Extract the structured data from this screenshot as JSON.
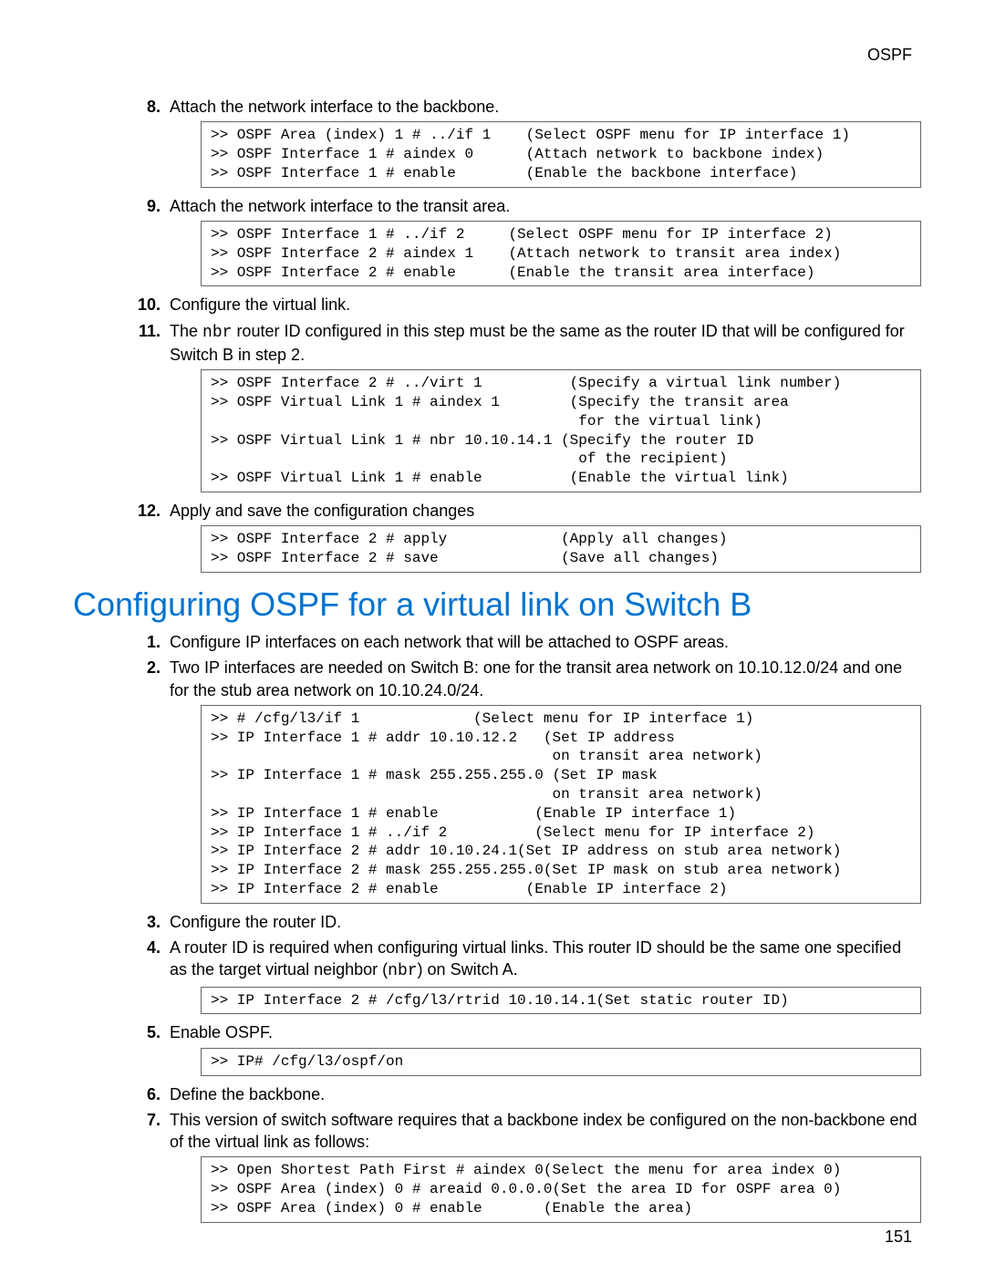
{
  "header": {
    "right": "OSPF"
  },
  "page_number": "151",
  "section_heading": "Configuring OSPF for a virtual link on Switch B",
  "stepsA": [
    {
      "num": "8.",
      "text": "Attach the network interface to the backbone."
    },
    {
      "num": "9.",
      "text": "Attach the network interface to the transit area."
    },
    {
      "num": "10.",
      "text": "Configure the virtual link."
    },
    {
      "num": "11.",
      "text_pre": "The ",
      "text_code": "nbr",
      "text_post": " router ID configured in this step must be the same as the router ID that will be configured for Switch B in step 2."
    },
    {
      "num": "12.",
      "text": "Apply and save the configuration changes"
    }
  ],
  "codeA": {
    "box1": ">> OSPF Area (index) 1 # ../if 1    (Select OSPF menu for IP interface 1)\n>> OSPF Interface 1 # aindex 0      (Attach network to backbone index)\n>> OSPF Interface 1 # enable        (Enable the backbone interface)",
    "box2": ">> OSPF Interface 1 # ../if 2     (Select OSPF menu for IP interface 2)\n>> OSPF Interface 2 # aindex 1    (Attach network to transit area index)\n>> OSPF Interface 2 # enable      (Enable the transit area interface)",
    "box3": ">> OSPF Interface 2 # ../virt 1          (Specify a virtual link number)\n>> OSPF Virtual Link 1 # aindex 1        (Specify the transit area\n                                          for the virtual link)\n>> OSPF Virtual Link 1 # nbr 10.10.14.1 (Specify the router ID\n                                          of the recipient)\n>> OSPF Virtual Link 1 # enable          (Enable the virtual link)",
    "box4": ">> OSPF Interface 2 # apply             (Apply all changes)\n>> OSPF Interface 2 # save              (Save all changes)"
  },
  "stepsB": [
    {
      "num": "1.",
      "text": "Configure IP interfaces on each network that will be attached to OSPF areas."
    },
    {
      "num": "2.",
      "text": "Two IP interfaces are needed on Switch B: one for the transit area network on 10.10.12.0/24 and one for the stub area network on 10.10.24.0/24."
    },
    {
      "num": "3.",
      "text": "Configure the router ID."
    },
    {
      "num": "4.",
      "text_pre": "A router ID is required when configuring virtual links. This router ID should be the same one specified as the target virtual neighbor (",
      "text_code": "nbr",
      "text_post": ") on Switch A."
    },
    {
      "num": "5.",
      "text": "Enable OSPF."
    },
    {
      "num": "6.",
      "text": "Define the backbone."
    },
    {
      "num": "7.",
      "text": "This version of switch software requires that a backbone index be configured on the non-backbone end of the virtual link as follows:"
    }
  ],
  "codeB": {
    "box1": ">> # /cfg/l3/if 1             (Select menu for IP interface 1)\n>> IP Interface 1 # addr 10.10.12.2   (Set IP address\n                                       on transit area network)\n>> IP Interface 1 # mask 255.255.255.0 (Set IP mask\n                                       on transit area network)\n>> IP Interface 1 # enable           (Enable IP interface 1)\n>> IP Interface 1 # ../if 2          (Select menu for IP interface 2)\n>> IP Interface 2 # addr 10.10.24.1(Set IP address on stub area network)\n>> IP Interface 2 # mask 255.255.255.0(Set IP mask on stub area network)\n>> IP Interface 2 # enable          (Enable IP interface 2)",
    "box2": ">> IP Interface 2 # /cfg/l3/rtrid 10.10.14.1(Set static router ID)",
    "box3": ">> IP# /cfg/l3/ospf/on",
    "box4": ">> Open Shortest Path First # aindex 0(Select the menu for area index 0)\n>> OSPF Area (index) 0 # areaid 0.0.0.0(Set the area ID for OSPF area 0)\n>> OSPF Area (index) 0 # enable       (Enable the area)"
  }
}
